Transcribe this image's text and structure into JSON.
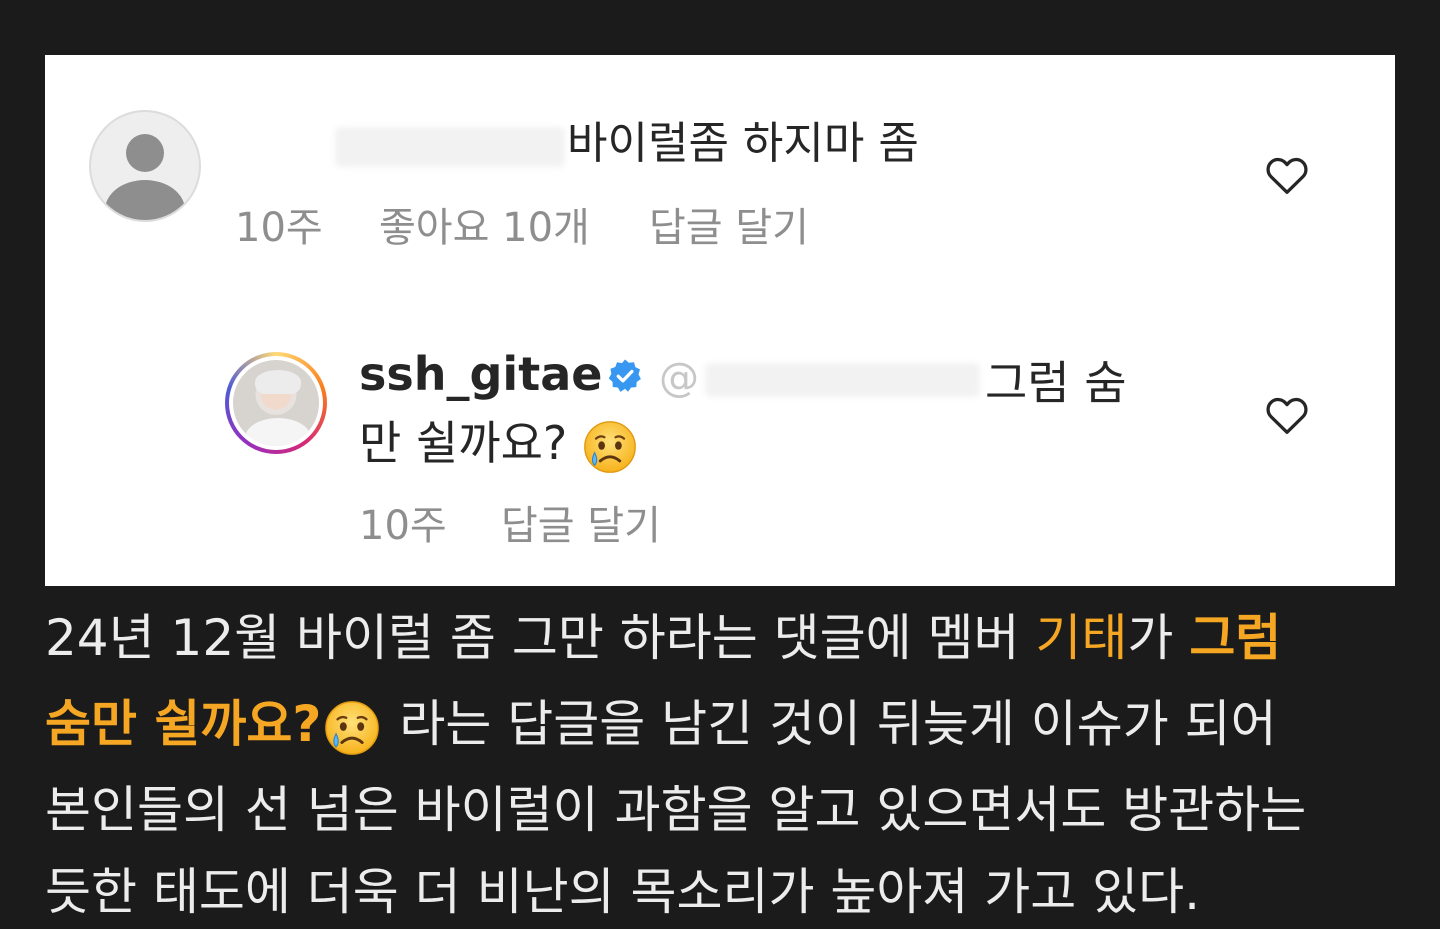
{
  "comment1": {
    "text": "바이럴좀 하지마 좀",
    "time": "10주",
    "likes": "좋아요 10개",
    "reply": "답글 달기"
  },
  "comment2": {
    "username": "ssh_gitae",
    "mention_prefix": "@",
    "text_tail": "그럼 숨",
    "text_line2": "만 쉴까요?",
    "time": "10주",
    "reply": "답글 달기"
  },
  "caption": {
    "line1_a": "24년 12월 바이럴 좀 그만 하라는 댓글에 멤버 ",
    "line1_name": "기태",
    "line1_b": "가 ",
    "line1_quote": "그럼",
    "line2_quote": "숨만 쉴까요?",
    "line2_b": " 라는 답글을 남긴 것이 뒤늦게 이슈가 되어",
    "line3": "본인들의 선 넘은 바이럴이 과함을 알고 있으면서도 방관하는",
    "line4": "듯한 태도에 더욱 더 비난의 목소리가 높아져 가고 있다."
  },
  "colors": {
    "background": "#1b1b1b",
    "caption_text": "#ececec",
    "highlight": "#f5a623",
    "meta_text": "#8e8e8e",
    "verified": "#3897f0"
  },
  "icons": [
    "default-avatar-icon",
    "heart-icon",
    "verified-badge-icon",
    "crying-face-emoji"
  ]
}
